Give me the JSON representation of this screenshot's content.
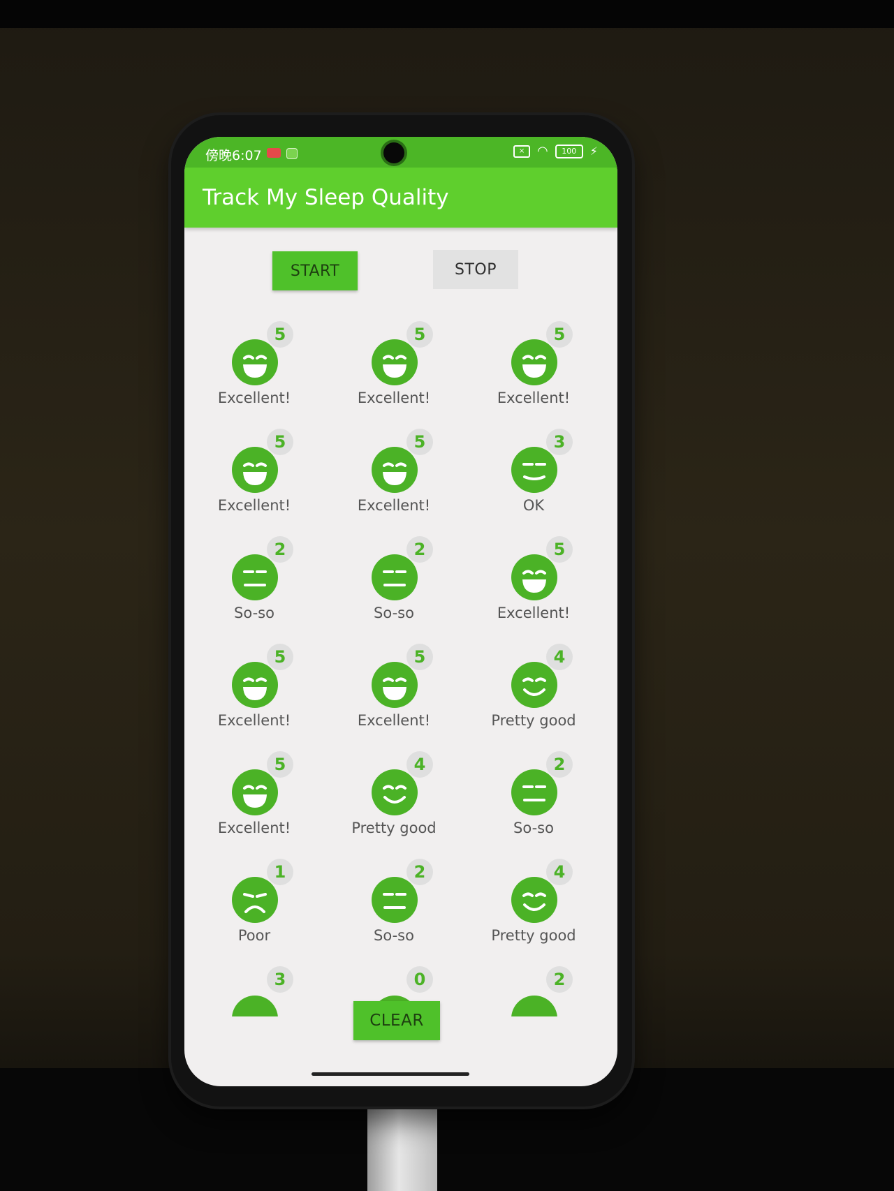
{
  "status_bar": {
    "time": "傍晚6:07",
    "battery": "100"
  },
  "app_bar": {
    "title": "Track My Sleep Quality"
  },
  "controls": {
    "start_label": "START",
    "stop_label": "STOP",
    "clear_label": "CLEAR"
  },
  "nights": [
    {
      "score": "5",
      "label": "Excellent!",
      "mood": "excellent"
    },
    {
      "score": "5",
      "label": "Excellent!",
      "mood": "excellent"
    },
    {
      "score": "5",
      "label": "Excellent!",
      "mood": "excellent"
    },
    {
      "score": "5",
      "label": "Excellent!",
      "mood": "excellent"
    },
    {
      "score": "5",
      "label": "Excellent!",
      "mood": "excellent"
    },
    {
      "score": "3",
      "label": "OK",
      "mood": "ok"
    },
    {
      "score": "2",
      "label": "So-so",
      "mood": "soso"
    },
    {
      "score": "2",
      "label": "So-so",
      "mood": "soso"
    },
    {
      "score": "5",
      "label": "Excellent!",
      "mood": "excellent"
    },
    {
      "score": "5",
      "label": "Excellent!",
      "mood": "excellent"
    },
    {
      "score": "5",
      "label": "Excellent!",
      "mood": "excellent"
    },
    {
      "score": "4",
      "label": "Pretty good",
      "mood": "pretty_good"
    },
    {
      "score": "5",
      "label": "Excellent!",
      "mood": "excellent"
    },
    {
      "score": "4",
      "label": "Pretty good",
      "mood": "pretty_good"
    },
    {
      "score": "2",
      "label": "So-so",
      "mood": "soso"
    },
    {
      "score": "1",
      "label": "Poor",
      "mood": "poor"
    },
    {
      "score": "2",
      "label": "So-so",
      "mood": "soso"
    },
    {
      "score": "4",
      "label": "Pretty good",
      "mood": "pretty_good"
    },
    {
      "score": "3",
      "label": "",
      "mood": "partial"
    },
    {
      "score": "0",
      "label": "",
      "mood": "partial"
    },
    {
      "score": "2",
      "label": "",
      "mood": "partial"
    }
  ],
  "colors": {
    "accent": "#5fcf2d",
    "face": "#4bb226",
    "status": "#4cb626"
  }
}
